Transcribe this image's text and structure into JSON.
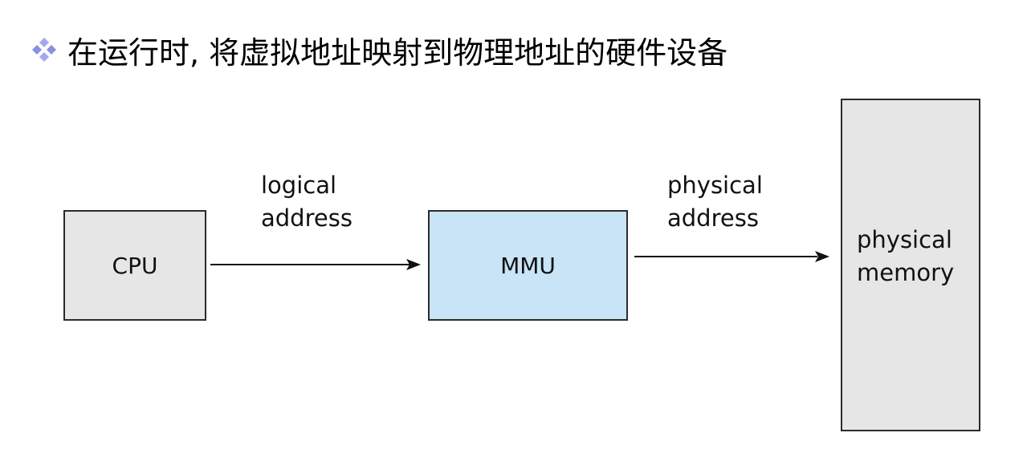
{
  "slide": {
    "title": "在运行时, 将虚拟地址映射到物理地址的硬件设备"
  },
  "diagram": {
    "cpu_label": "CPU",
    "mmu_label": "MMU",
    "memory_label": "physical\nmemory",
    "logical_address_label": "logical\naddress",
    "physical_address_label": "physical\naddress"
  },
  "colors": {
    "cpu_fill": "#e6e6e6",
    "mmu_fill": "#c8e4f6",
    "memory_fill": "#e6e6e6",
    "bullet": "#8a8fe0",
    "border": "#2b2b2b"
  },
  "icons": {
    "bullet": "four-diamond-bullet-icon"
  }
}
